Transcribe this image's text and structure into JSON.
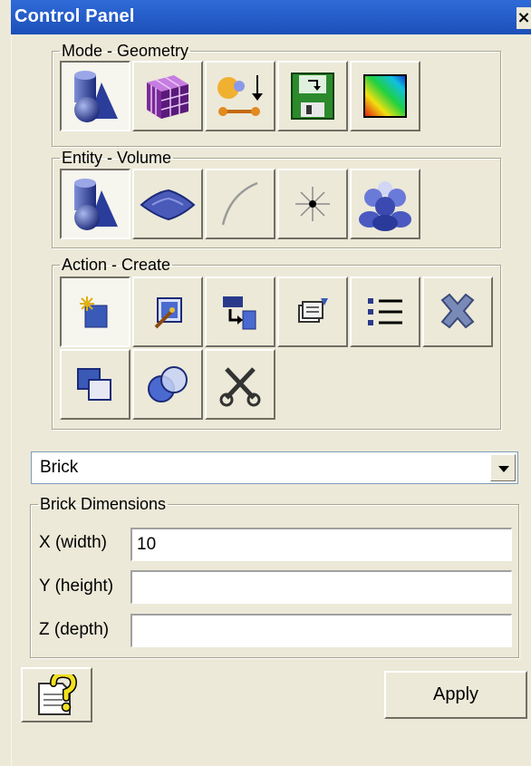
{
  "window": {
    "title": "Control Panel",
    "close_glyph": "×"
  },
  "mode_group": {
    "legend": "Mode - Geometry",
    "buttons": [
      {
        "icon": "geometry-mode-icon",
        "pressed": true
      },
      {
        "icon": "mesh-mode-icon",
        "pressed": false
      },
      {
        "icon": "boundary-conditions-icon",
        "pressed": false
      },
      {
        "icon": "save-export-icon",
        "pressed": false
      },
      {
        "icon": "results-plot-icon",
        "pressed": false
      }
    ]
  },
  "entity_group": {
    "legend": "Entity - Volume",
    "buttons": [
      {
        "icon": "volume-entity-icon",
        "pressed": true
      },
      {
        "icon": "surface-entity-icon",
        "pressed": false
      },
      {
        "icon": "curve-entity-icon",
        "pressed": false
      },
      {
        "icon": "vertex-entity-icon",
        "pressed": false
      },
      {
        "icon": "group-entity-icon",
        "pressed": false
      }
    ]
  },
  "action_group": {
    "legend": "Action - Create",
    "buttons": [
      {
        "icon": "create-icon",
        "pressed": true
      },
      {
        "icon": "modify-icon",
        "pressed": false
      },
      {
        "icon": "transform-icon",
        "pressed": false
      },
      {
        "icon": "properties-icon",
        "pressed": false
      },
      {
        "icon": "list-icon",
        "pressed": false
      },
      {
        "icon": "delete-icon",
        "pressed": false
      },
      {
        "icon": "copy-icon",
        "pressed": false
      },
      {
        "icon": "boolean-icon",
        "pressed": false
      },
      {
        "icon": "cut-icon",
        "pressed": false
      }
    ]
  },
  "shape_select": {
    "value": "Brick"
  },
  "dimensions": {
    "legend": "Brick Dimensions",
    "fields": [
      {
        "label": "X (width)",
        "value": "10"
      },
      {
        "label": "Y (height)",
        "value": ""
      },
      {
        "label": "Z (depth)",
        "value": ""
      }
    ]
  },
  "footer": {
    "help_icon": "help-icon",
    "apply_label": "Apply"
  }
}
